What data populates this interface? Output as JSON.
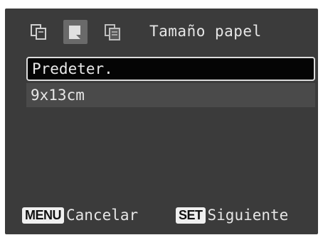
{
  "header": {
    "tabs": [
      {
        "icon": "print-settings-icon",
        "active": false
      },
      {
        "icon": "paper-size-icon",
        "active": true
      },
      {
        "icon": "paper-type-icon",
        "active": false
      }
    ],
    "title": "Tamaño papel"
  },
  "options": [
    {
      "label": "Predeter.",
      "selected": true
    },
    {
      "label": "9x13cm",
      "selected": false
    }
  ],
  "footer": {
    "menu_key": "MENU",
    "menu_label": "Cancelar",
    "set_key": "SET",
    "set_label": "Siguiente"
  },
  "colors": {
    "screen_bg": "#3b3b3b",
    "selected_bg": "#050505",
    "item_bg": "#4a4a4a",
    "text": "#e6e6e6"
  }
}
